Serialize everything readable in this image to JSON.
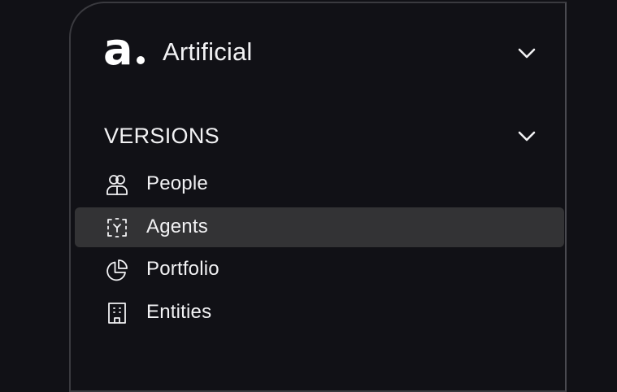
{
  "brand": {
    "logo_letter": "a",
    "name": "Artificial",
    "chevron_icon": "chevron-down-icon"
  },
  "section": {
    "title": "VERSIONS",
    "chevron_icon": "chevron-down-icon"
  },
  "nav": {
    "items": [
      {
        "label": "People",
        "icon": "people-icon",
        "active": false
      },
      {
        "label": "Agents",
        "icon": "agents-icon",
        "active": true
      },
      {
        "label": "Portfolio",
        "icon": "pie-chart-icon",
        "active": false
      },
      {
        "label": "Entities",
        "icon": "building-icon",
        "active": false
      }
    ]
  },
  "colors": {
    "background": "#111116",
    "active_item": "#333335",
    "border": "#3a3a3f",
    "text": "#f2f2f4"
  }
}
